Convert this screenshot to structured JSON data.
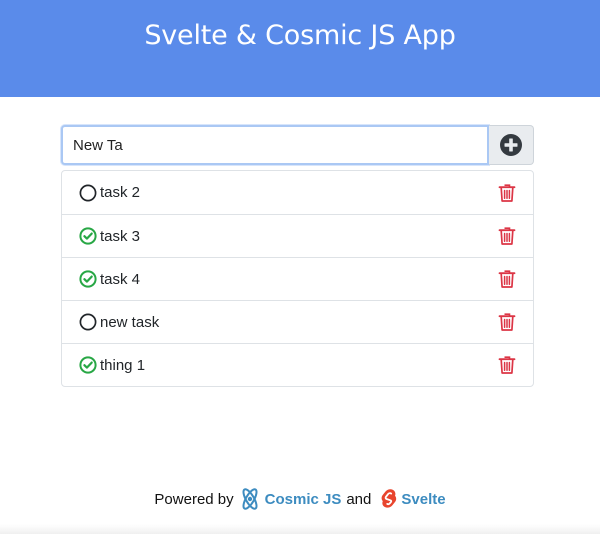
{
  "header": {
    "title": "Svelte & Cosmic JS App",
    "background": "#5a8bea"
  },
  "new_task": {
    "value": "New Ta",
    "add_icon": "plus-circle-icon"
  },
  "tasks": [
    {
      "label": "task 2",
      "completed": false
    },
    {
      "label": "task 3",
      "completed": true
    },
    {
      "label": "task 4",
      "completed": true
    },
    {
      "label": "new task",
      "completed": false
    },
    {
      "label": "thing 1",
      "completed": true
    }
  ],
  "colors": {
    "done": "#28a745",
    "delete": "#dc3545"
  },
  "footer": {
    "powered_by": "Powered by",
    "cosmic": "Cosmic JS",
    "and": "and",
    "svelte": "Svelte"
  }
}
